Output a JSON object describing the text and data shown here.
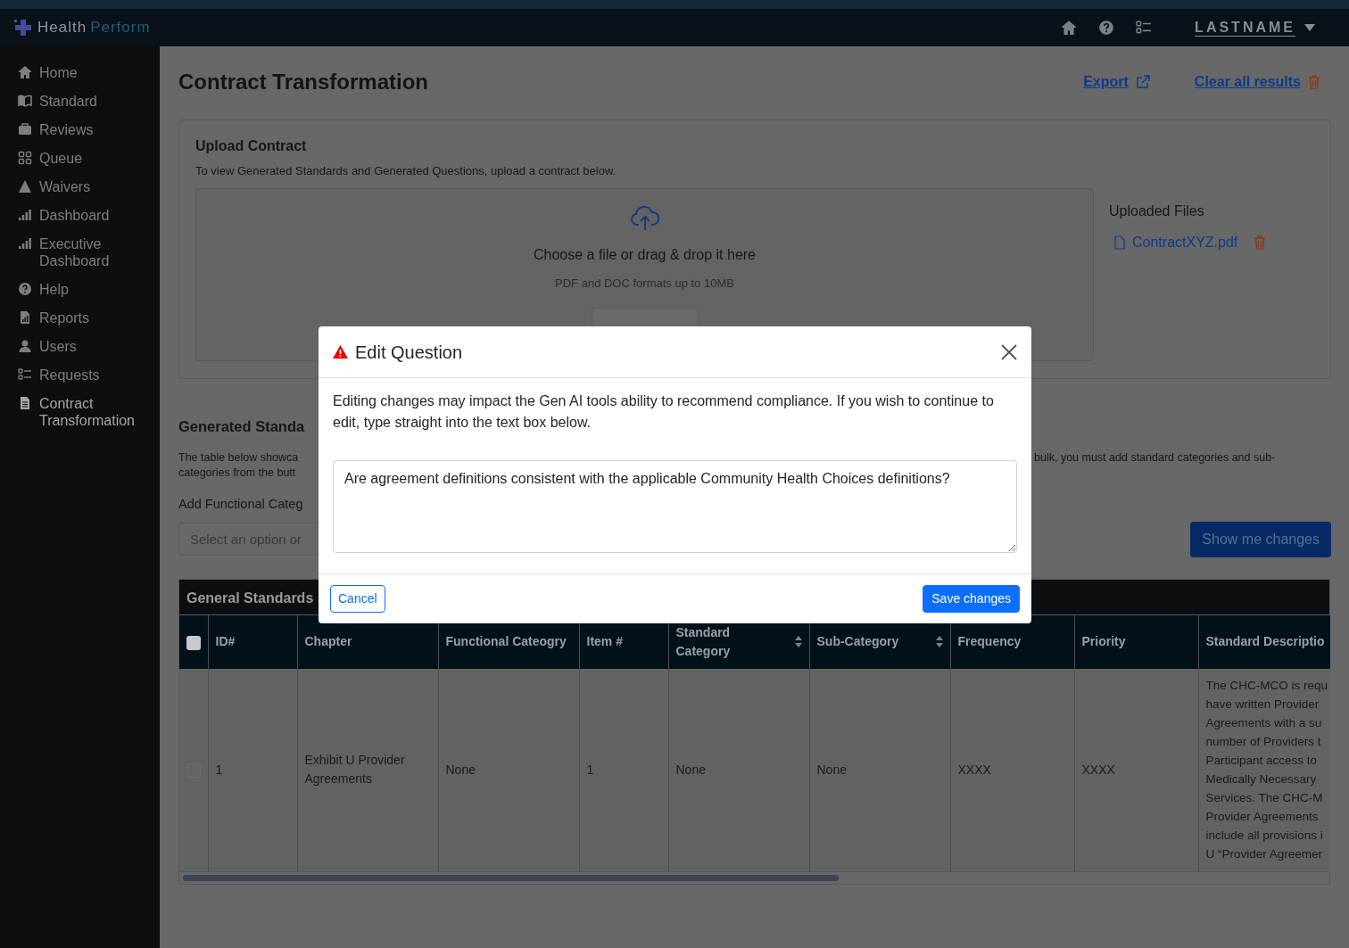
{
  "app": {
    "logo_first": "Health",
    "logo_second": "Perform",
    "user": "LASTNAME"
  },
  "sidebar": {
    "items": [
      {
        "label": "Home",
        "kind": "home",
        "selected": false
      },
      {
        "label": "Standard",
        "kind": "book",
        "selected": false
      },
      {
        "label": "Reviews",
        "kind": "briefcase",
        "selected": false
      },
      {
        "label": "Queue",
        "kind": "grid",
        "selected": false
      },
      {
        "label": "Waivers",
        "kind": "warning",
        "selected": false
      },
      {
        "label": "Dashboard",
        "kind": "bars",
        "selected": false
      },
      {
        "label": "Executive Dashboard",
        "kind": "bars",
        "selected": false
      },
      {
        "label": "Help",
        "kind": "help",
        "selected": false
      },
      {
        "label": "Reports",
        "kind": "report",
        "selected": false
      },
      {
        "label": "Users",
        "kind": "user",
        "selected": false
      },
      {
        "label": "Requests",
        "kind": "checklist",
        "selected": false
      },
      {
        "label": "Contract Transformation",
        "kind": "document",
        "selected": true
      }
    ]
  },
  "page": {
    "title": "Contract Transformation",
    "actions": [
      {
        "label": "Export",
        "kind": "export"
      },
      {
        "label": "Clear all results",
        "kind": "clear"
      }
    ]
  },
  "upload": {
    "title": "Upload Contract",
    "instructions": "To view Generated Standards and Generated Questions, upload a contract below.",
    "prompt": "Choose a file or drag & drop it here",
    "formats": "PDF and DOC formats up to 10MB",
    "uploaded_title": "Uploaded Files",
    "files": [
      "ContractXYZ.pdf"
    ]
  },
  "generated": {
    "title": "Generated Standa",
    "description_left": [
      "The table below showca",
      "categories from the butt"
    ],
    "description_right": "bulk, you must add standard categories and sub-",
    "field_label": "Add Functional Categ",
    "field_placeholder": "Select an option or",
    "button": "Show me changes"
  },
  "table": {
    "title": "General Standards",
    "select_all_checked": false,
    "columns": [
      {
        "label": "ID#",
        "sortable": false
      },
      {
        "label": "Chapter",
        "sortable": false
      },
      {
        "label": "Functional Cateogry",
        "sortable": false
      },
      {
        "label": "Item #",
        "sortable": false
      },
      {
        "label": "Standard Category",
        "sortable": true
      },
      {
        "label": "Sub-Category",
        "sortable": true
      },
      {
        "label": "Frequency",
        "sortable": false
      },
      {
        "label": "Priority",
        "sortable": false
      },
      {
        "label": "Standard Descriptio",
        "sortable": false
      }
    ],
    "rows": [
      {
        "checked": false,
        "cells": [
          "1",
          "Exhibit U Provider Agreements",
          "None",
          "1",
          "None",
          "None",
          "XXXX",
          "XXXX"
        ],
        "description_lines": [
          "The CHC-MCO is requ",
          "have written Provider",
          "Agreements with a su",
          "number of Providers t",
          "Participant access to",
          "Medically Necessary",
          "Services. The CHC-M",
          "Provider Agreements",
          "include all provisions i",
          "U “Provider Agreemer"
        ]
      }
    ]
  },
  "modal": {
    "title": "Edit Question",
    "message": "Editing changes may impact the Gen AI tools ability to recommend compliance. If you wish to continue to edit, type straight into the text box below.",
    "value": "Are agreement definitions consistent with the applicable Community Health Choices definitions?",
    "cancel": "Cancel",
    "save": "Save changes"
  }
}
